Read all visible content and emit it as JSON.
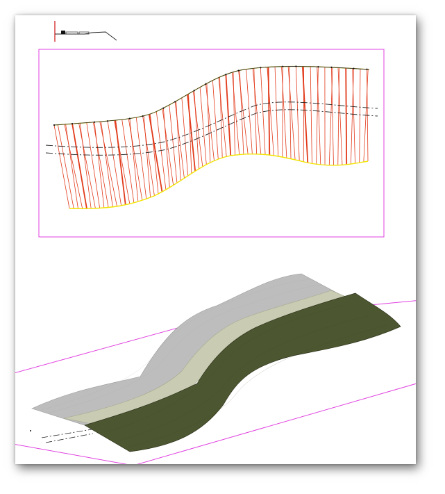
{
  "canvas": {
    "background": "#ffffff",
    "colors": {
      "viewport_border": "#e040e0",
      "section_lines": "#e23a1a",
      "road_edge": "#303030",
      "daylight_line": "#f2e400",
      "alignment_line": "#222222",
      "ucs_axis_red": "#d01010",
      "surface_road": "#bdbdbd",
      "surface_shoulder": "#c9cbb3",
      "surface_slope": "#4c5630"
    }
  },
  "icons": {
    "assembly": "assembly-preview-icon",
    "ucs": "ucs-icon"
  },
  "views": {
    "plan": "plan-view",
    "model": "3d-model-view"
  }
}
